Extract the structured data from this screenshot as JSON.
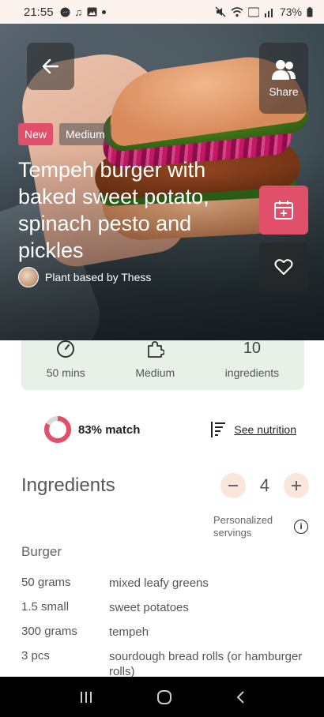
{
  "status_bar": {
    "time": "21:55",
    "battery": "73%"
  },
  "hero": {
    "share_label": "Share",
    "tags": [
      "New",
      "Medium"
    ],
    "title": "Tempeh burger with baked sweet potato, spinach pesto and pickles",
    "author": "Plant based by Thess"
  },
  "stats": {
    "time": "50 mins",
    "difficulty": "Medium",
    "ingredients_count": "10",
    "ingredients_label": "ingredients"
  },
  "match": {
    "label": "83% match",
    "percent": 83
  },
  "nutrition_link": "See nutrition",
  "ingredients": {
    "title": "Ingredients",
    "servings": "4",
    "personalized_label": "Personalized servings",
    "section": "Burger",
    "items": [
      {
        "qty": "50 grams",
        "name": "mixed leafy greens"
      },
      {
        "qty": "1.5 small",
        "name": "sweet potatoes"
      },
      {
        "qty": "300 grams",
        "name": "tempeh"
      },
      {
        "qty": "3 pcs",
        "name": "sourdough bread rolls (or hamburger rolls)"
      }
    ]
  },
  "colors": {
    "accent": "#e0506a",
    "stats_bg": "#e8f1e8",
    "servings_btn": "#fbe6dc"
  }
}
